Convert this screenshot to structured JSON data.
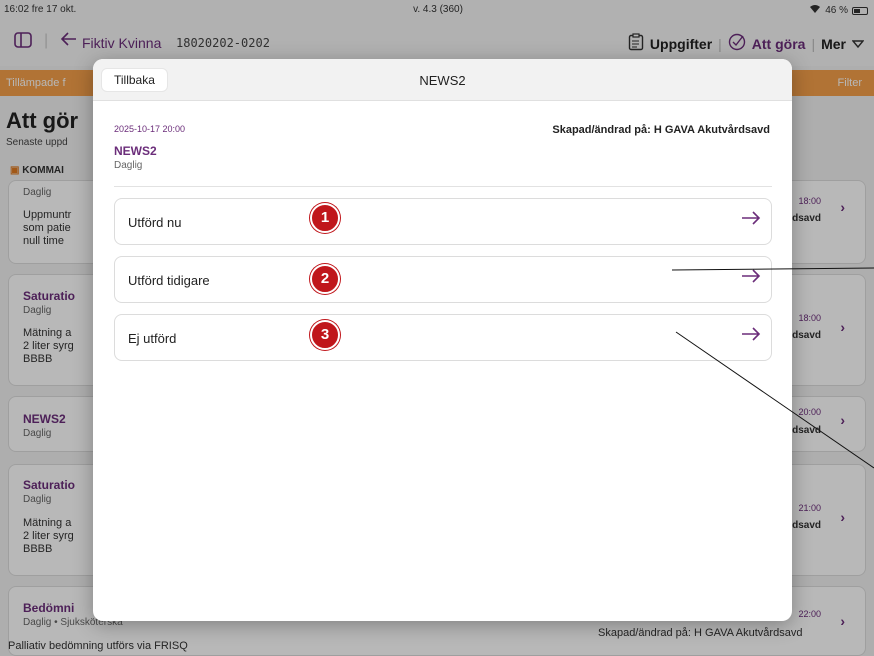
{
  "status_bar": {
    "time_date": "16:02  fre 17 okt.",
    "version": "v. 4.3 (360)",
    "battery": "46 %"
  },
  "nav": {
    "patient_name": "Fiktiv Kvinna",
    "personnummer": "18020202-0202",
    "tasks_label": "Uppgifter",
    "todo_label": "Att göra",
    "more_label": "Mer",
    "accent": "#6b2d7a"
  },
  "filter_bar": {
    "left_text": "Tillämpade f",
    "right_text": "Filter",
    "color": "#f5a04a"
  },
  "background": {
    "title": "Att gör",
    "subtitle": "Senaste uppd",
    "section": "KOMMAI",
    "cards": [
      {
        "sub": "Daglig",
        "desc": [
          "Uppmuntr",
          "som patie",
          "null time"
        ],
        "time": "18:00",
        "unit": "dsavd"
      },
      {
        "title": "Saturatio",
        "sub": "Daglig",
        "desc": [
          "Mätning a",
          "2 liter syrg",
          "BBBB"
        ],
        "time": "18:00",
        "unit": "dsavd"
      },
      {
        "title": "NEWS2",
        "sub": "Daglig",
        "time": "20:00",
        "unit": "dsavd"
      },
      {
        "title": "Saturatio",
        "sub": "Daglig",
        "desc": [
          "Mätning a",
          "2 liter syrg",
          "BBBB"
        ],
        "time": "21:00",
        "unit": "dsavd"
      },
      {
        "title": "Bedömni",
        "sub": "Daglig • Sjuksköterska",
        "time": "22:00"
      }
    ],
    "bottom_desc": "Palliativ bedömning utförs via FRISQ",
    "bottom_unit": "Skapad/ändrad på: H GAVA Akutvårdsavd"
  },
  "modal": {
    "back_label": "Tillbaka",
    "title": "NEWS2",
    "datetime": "2025-10-17 20:00",
    "created_by": "Skapad/ändrad på: H GAVA Akutvårdsavd",
    "task_name": "NEWS2",
    "frequency": "Daglig",
    "options": [
      {
        "label": "Utförd nu",
        "badge": "1"
      },
      {
        "label": "Utförd tidigare",
        "badge": "2"
      },
      {
        "label": "Ej utförd",
        "badge": "3"
      }
    ]
  }
}
